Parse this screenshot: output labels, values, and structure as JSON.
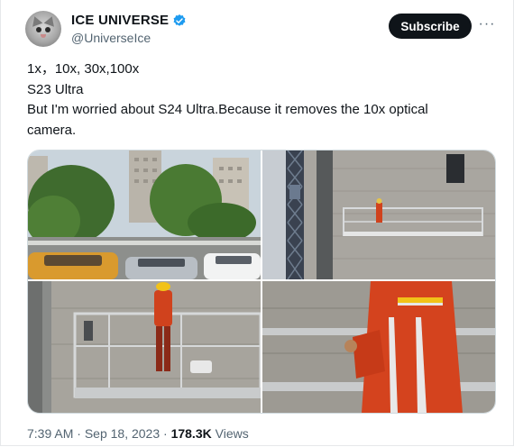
{
  "author": {
    "display_name": "ICE UNIVERSE",
    "handle": "@UniverseIce",
    "verified": true,
    "avatar_icon": "cat-avatar"
  },
  "actions": {
    "subscribe_label": "Subscribe",
    "more_label": "···"
  },
  "tweet": {
    "lines": [
      "1x，10x, 30x,100x",
      "S23 Ultra",
      "But I'm worried about S24 Ultra.Because it removes the 10x optical",
      "camera."
    ]
  },
  "media": {
    "count": 4
  },
  "meta": {
    "time": "7:39 AM",
    "separator": "·",
    "date": "Sep 18, 2023",
    "views_count": "178.3K",
    "views_label": "Views"
  },
  "colors": {
    "accent": "#1d9bf0",
    "text_primary": "#0f1419",
    "text_secondary": "#536471",
    "button_bg": "#0f1419"
  }
}
